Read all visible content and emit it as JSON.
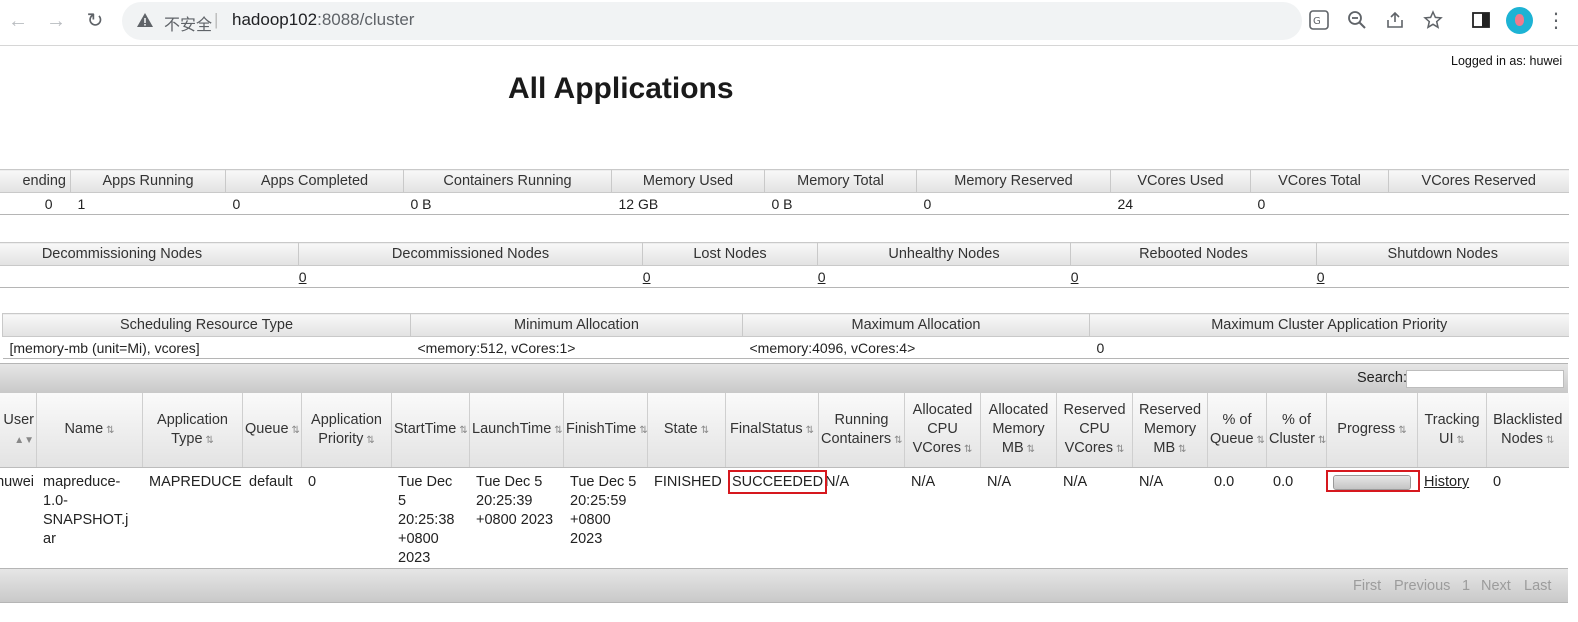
{
  "browser": {
    "security_text": "不安全",
    "url_host": "hadoop102",
    "url_rest": ":8088/cluster"
  },
  "page": {
    "logged_in": "Logged in as: huwei",
    "title": "All Applications"
  },
  "cluster_metrics": {
    "headers": [
      "ending",
      "Apps Running",
      "Apps Completed",
      "Containers Running",
      "Memory Used",
      "Memory Total",
      "Memory Reserved",
      "VCores Used",
      "VCores Total",
      "VCores Reserved"
    ],
    "values": [
      "0",
      "1",
      "0",
      "0 B",
      "12 GB",
      "0 B",
      "0",
      "24",
      "0",
      ""
    ]
  },
  "node_metrics": {
    "headers": [
      "Decommissioning Nodes",
      "Decommissioned Nodes",
      "Lost Nodes",
      "Unhealthy Nodes",
      "Rebooted Nodes",
      "Shutdown Nodes"
    ],
    "values": [
      "",
      "0",
      "0",
      "0",
      "0",
      "0"
    ]
  },
  "scheduler_metrics": {
    "headers": [
      "Scheduling Resource Type",
      "Minimum Allocation",
      "Maximum Allocation",
      "Maximum Cluster Application Priority"
    ],
    "values": [
      "[memory-mb (unit=Mi), vcores]",
      "<memory:512, vCores:1>",
      "<memory:4096, vCores:4>",
      "0"
    ]
  },
  "search": {
    "label": "Search:",
    "value": ""
  },
  "apps_table": {
    "headers": [
      "User",
      "Name",
      "Application Type",
      "Queue",
      "Application Priority",
      "StartTime",
      "LaunchTime",
      "FinishTime",
      "State",
      "FinalStatus",
      "Running Containers",
      "Allocated CPU VCores",
      "Allocated Memory MB",
      "Reserved CPU VCores",
      "Reserved Memory MB",
      "% of Queue",
      "% of Cluster",
      "Progress",
      "Tracking UI",
      "Blacklisted Nodes"
    ],
    "rows": [
      {
        "user": "huwei",
        "name": "mapreduce-1.0-SNAPSHOT.jar",
        "type": "MAPREDUCE",
        "queue": "default",
        "priority": "0",
        "start": "Tue Dec 5 20:25:38 +0800 2023",
        "launch": "Tue Dec 5 20:25:39 +0800 2023",
        "finish": "Tue Dec 5 20:25:59 +0800 2023",
        "state": "FINISHED",
        "final_status": "SUCCEEDED",
        "running_containers": "N/A",
        "alloc_cpu": "N/A",
        "alloc_mem": "N/A",
        "res_cpu": "N/A",
        "res_mem": "N/A",
        "pct_queue": "0.0",
        "pct_cluster": "0.0",
        "progress": 1.0,
        "tracking_ui": "History",
        "blacklisted": "0"
      }
    ]
  },
  "pager": {
    "first": "First",
    "previous": "Previous",
    "page": "1",
    "next": "Next",
    "last": "Last"
  }
}
